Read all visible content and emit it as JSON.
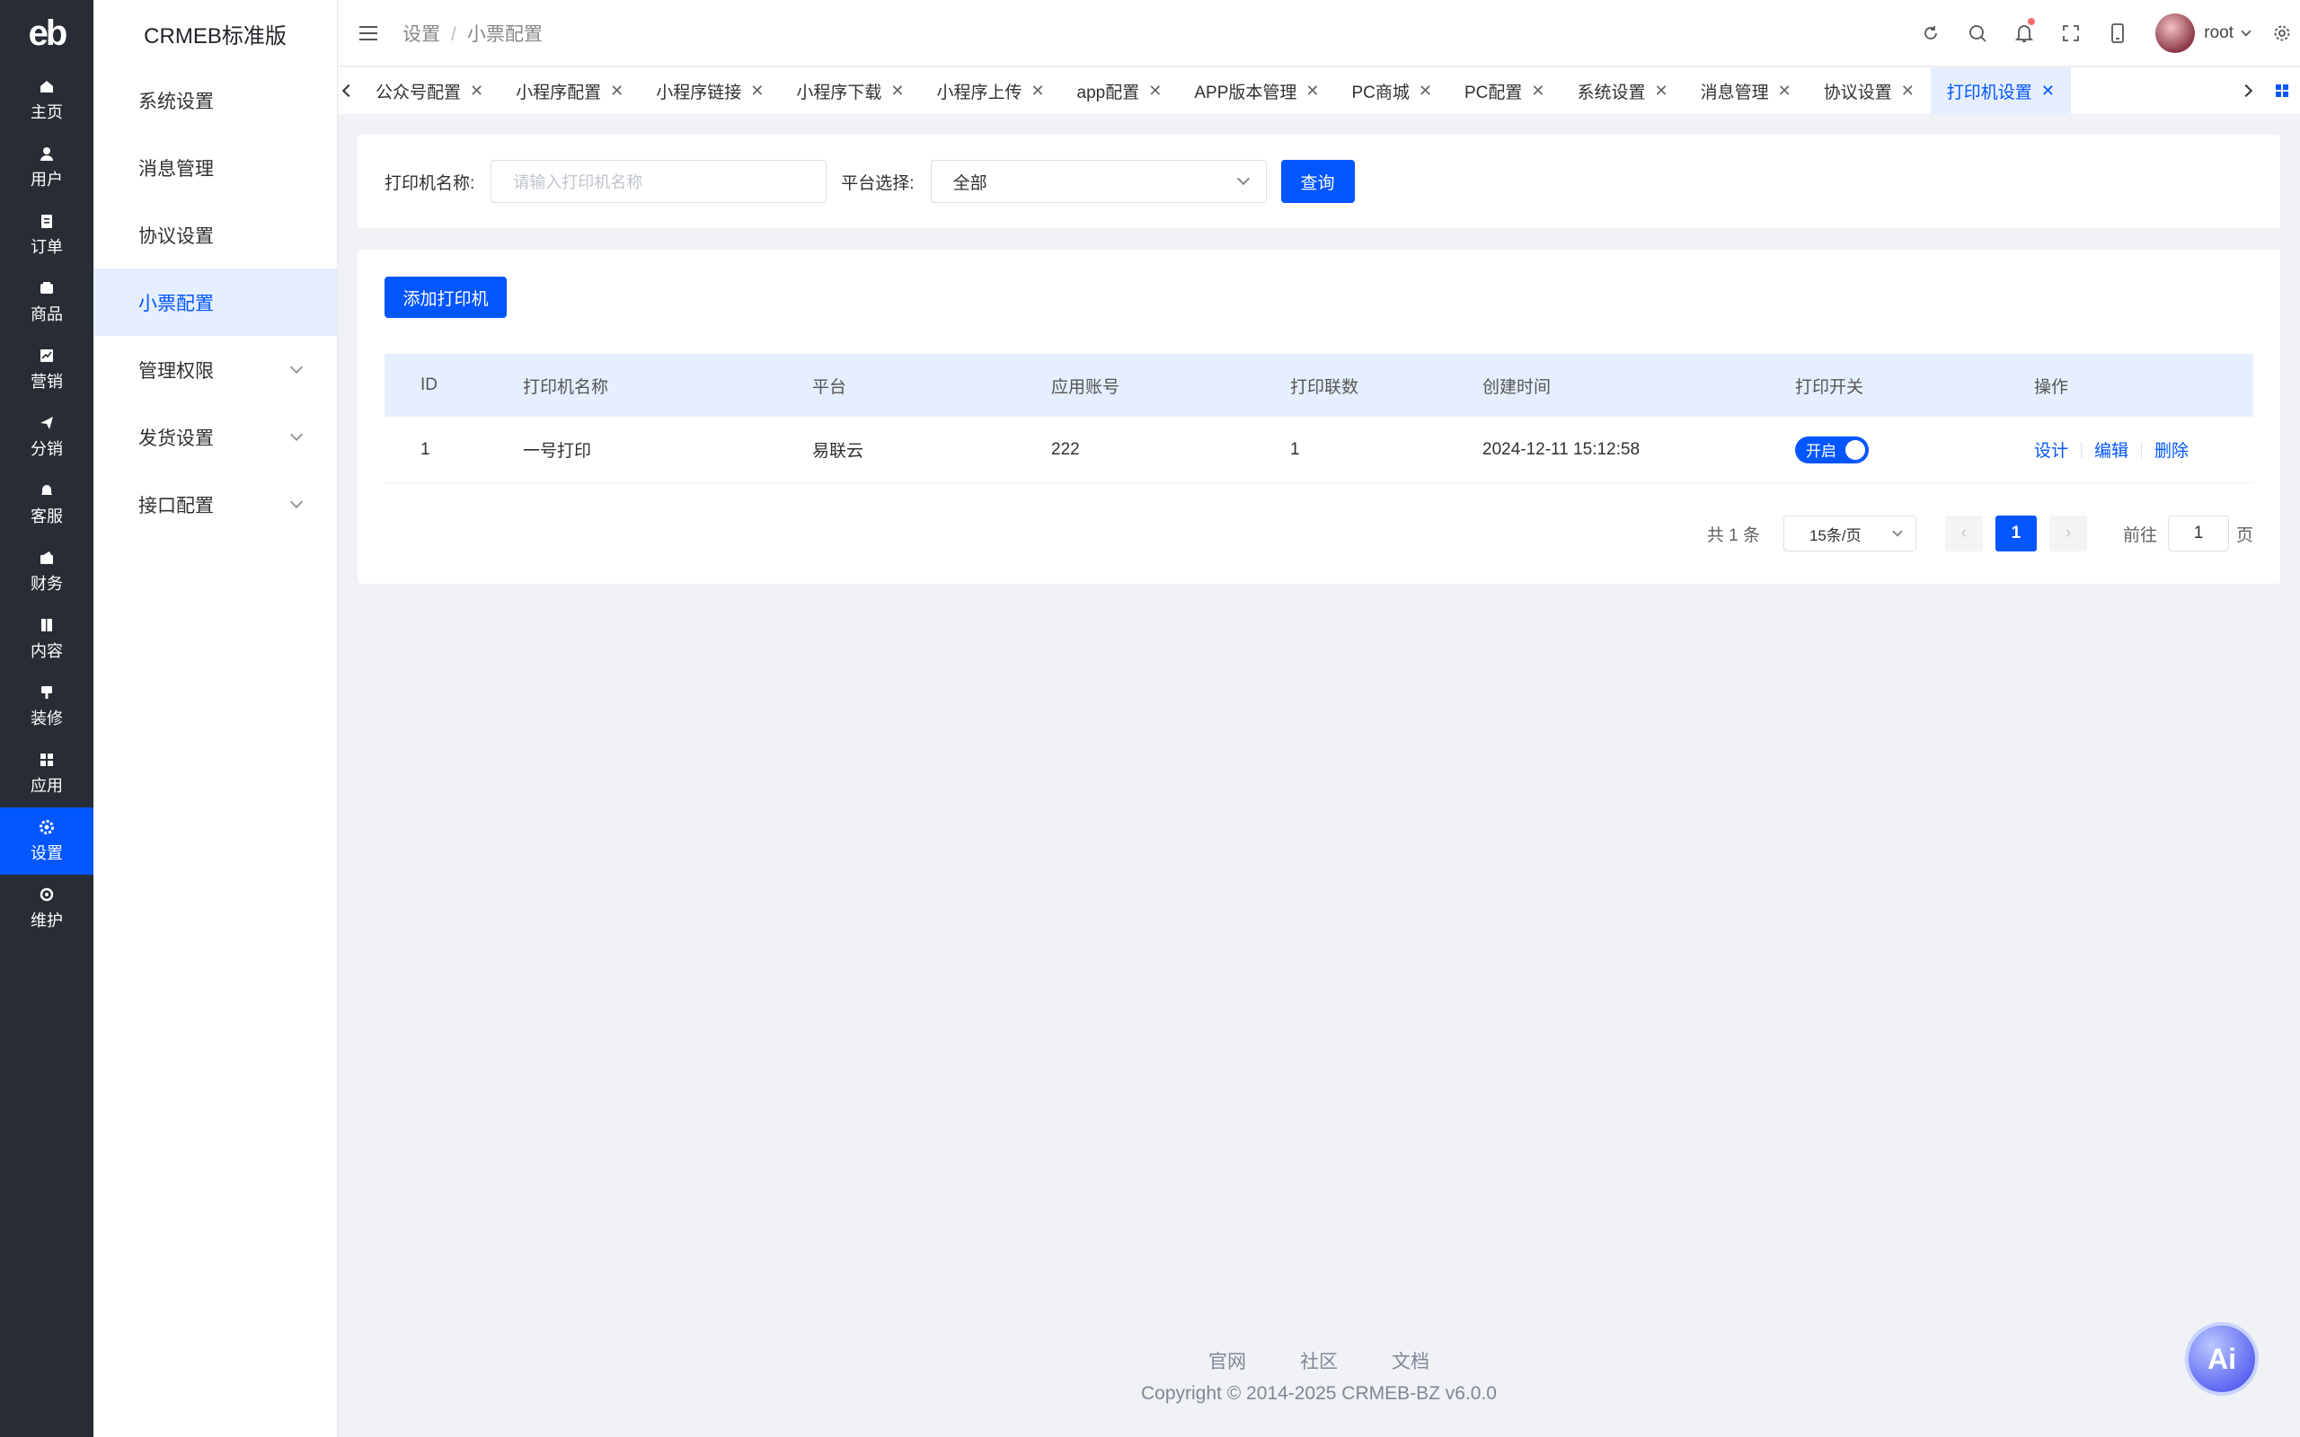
{
  "app": {
    "logo": "eb",
    "title": "CRMEB标准版"
  },
  "rail": [
    {
      "label": "主页",
      "icon": "home-icon"
    },
    {
      "label": "用户",
      "icon": "user-icon"
    },
    {
      "label": "订单",
      "icon": "order-icon"
    },
    {
      "label": "商品",
      "icon": "product-icon"
    },
    {
      "label": "营销",
      "icon": "marketing-icon"
    },
    {
      "label": "分销",
      "icon": "distribution-icon"
    },
    {
      "label": "客服",
      "icon": "service-icon"
    },
    {
      "label": "财务",
      "icon": "finance-icon"
    },
    {
      "label": "内容",
      "icon": "content-icon"
    },
    {
      "label": "装修",
      "icon": "decoration-icon"
    },
    {
      "label": "应用",
      "icon": "apps-icon"
    },
    {
      "label": "设置",
      "icon": "gear-icon",
      "active": true
    },
    {
      "label": "维护",
      "icon": "maintenance-icon"
    }
  ],
  "submenu": [
    {
      "label": "系统设置"
    },
    {
      "label": "消息管理"
    },
    {
      "label": "协议设置"
    },
    {
      "label": "小票配置",
      "active": true
    },
    {
      "label": "管理权限",
      "expandable": true
    },
    {
      "label": "发货设置",
      "expandable": true
    },
    {
      "label": "接口配置",
      "expandable": true
    }
  ],
  "breadcrumb": {
    "parent": "设置",
    "separator": "/",
    "current": "小票配置"
  },
  "user": {
    "name": "root"
  },
  "tabs": [
    {
      "label": "公众号配置"
    },
    {
      "label": "小程序配置"
    },
    {
      "label": "小程序链接"
    },
    {
      "label": "小程序下载"
    },
    {
      "label": "小程序上传"
    },
    {
      "label": "app配置"
    },
    {
      "label": "APP版本管理"
    },
    {
      "label": "PC商城"
    },
    {
      "label": "PC配置"
    },
    {
      "label": "系统设置"
    },
    {
      "label": "消息管理"
    },
    {
      "label": "协议设置"
    },
    {
      "label": "打印机设置",
      "active": true
    }
  ],
  "search": {
    "name_label": "打印机名称:",
    "name_placeholder": "请输入打印机名称",
    "platform_label": "平台选择:",
    "platform_value": "全部",
    "query_label": "查询"
  },
  "table": {
    "add_label": "添加打印机",
    "headers": {
      "id": "ID",
      "name": "打印机名称",
      "platform": "平台",
      "account": "应用账号",
      "copies": "打印联数",
      "created": "创建时间",
      "switch": "打印开关",
      "ops": "操作"
    },
    "rows": [
      {
        "id": "1",
        "name": "一号打印",
        "platform": "易联云",
        "account": "222",
        "copies": "1",
        "created": "2024-12-11 15:12:58",
        "switch_label": "开启",
        "switch_on": true,
        "op_design": "设计",
        "op_edit": "编辑",
        "op_delete": "删除"
      }
    ]
  },
  "pagination": {
    "total": "共 1 条",
    "page_size": "15条/页",
    "current": "1",
    "goto_label": "前往",
    "goto_value": "1",
    "page_suffix": "页"
  },
  "footer": {
    "links": [
      "官网",
      "社区",
      "文档"
    ],
    "copyright": "Copyright © 2014-2025 CRMEB-BZ v6.0.0"
  },
  "ai_button": "Ai",
  "colors": {
    "primary": "#0256ff",
    "rail_bg": "#282c34",
    "page_bg": "#f0f2f5"
  }
}
